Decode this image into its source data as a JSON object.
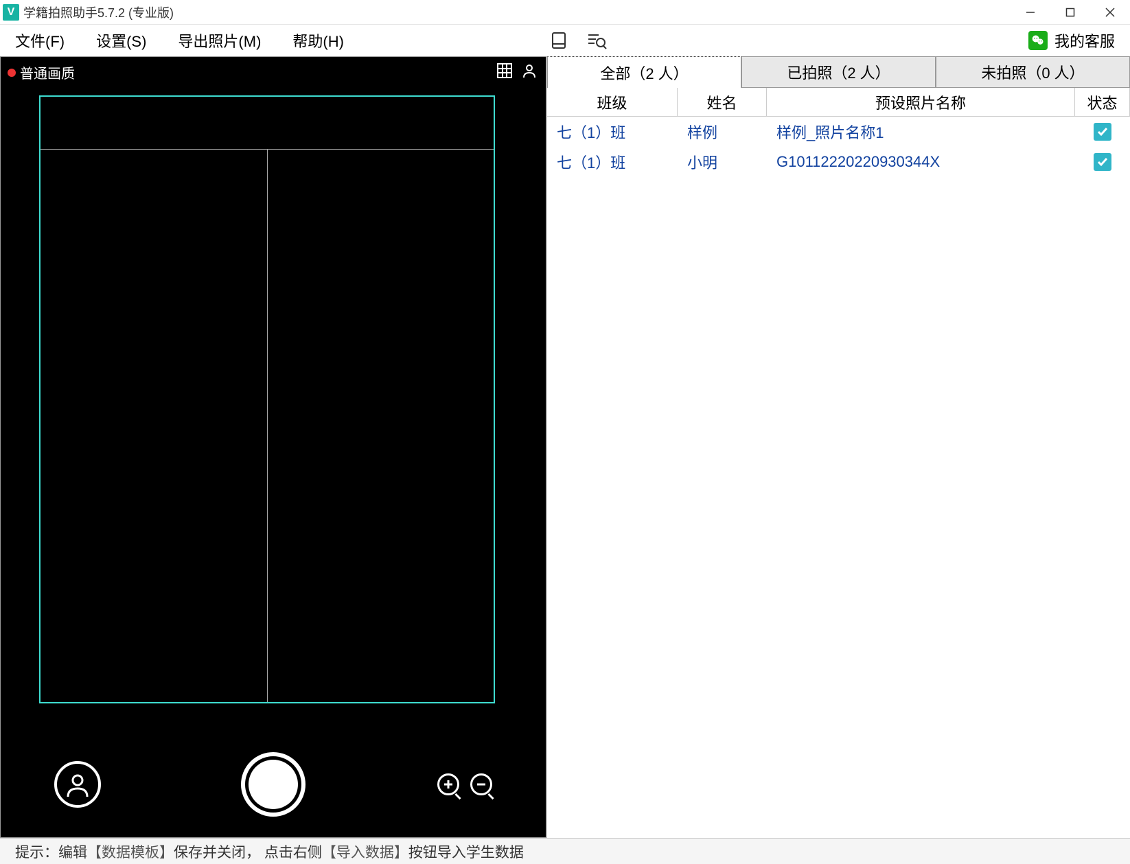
{
  "title": "学籍拍照助手5.7.2 (专业版)",
  "app_icon_letter": "V",
  "menu": {
    "file": "文件(F)",
    "settings": "设置(S)",
    "export": "导出照片(M)",
    "help": "帮助(H)"
  },
  "support_label": "我的客服",
  "camera": {
    "quality_label": "普通画质"
  },
  "tabs": {
    "all": "全部（2 人）",
    "taken": "已拍照（2 人）",
    "not_taken": "未拍照（0 人）"
  },
  "columns": {
    "class": "班级",
    "name": "姓名",
    "photo_name": "预设照片名称",
    "status": "状态"
  },
  "rows": [
    {
      "class": "七（1）班",
      "name": "样例",
      "photo_name": "样例_照片名称1",
      "status": true
    },
    {
      "class": "七（1）班",
      "name": "小明",
      "photo_name": "G10112220220930344X",
      "status": true
    }
  ],
  "footer": {
    "prefix": "提示：编辑",
    "template": "【数据模板】",
    "mid": "保存并关闭，  点击右侧",
    "import": "【导入数据】",
    "suffix": "按钮导入学生数据"
  }
}
